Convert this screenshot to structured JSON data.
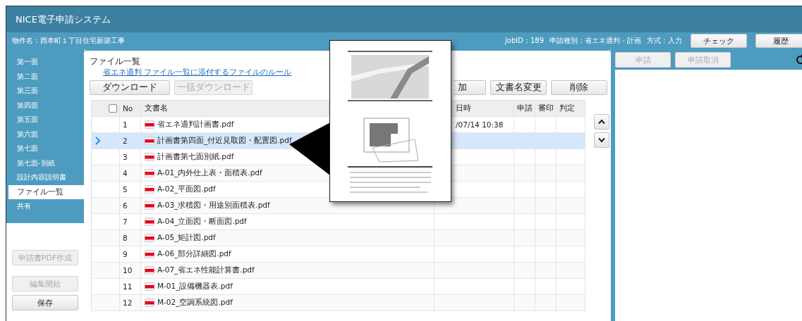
{
  "app_title": "NICE電子申請システム",
  "project_name": "物件名：西本町１丁目住宅新築工事",
  "job_info": [
    "JobID：189",
    "申請種別：省エネ適判 - 計画",
    "方式：入力"
  ],
  "header_buttons": [
    {
      "label": "チェック",
      "disabled": false
    },
    {
      "label": "履歴",
      "disabled": false
    }
  ],
  "sidebar": {
    "items": [
      {
        "label": "第一面",
        "selected": false
      },
      {
        "label": "第二面",
        "selected": false
      },
      {
        "label": "第三面",
        "selected": false
      },
      {
        "label": "第四面",
        "selected": false
      },
      {
        "label": "第五面",
        "selected": false
      },
      {
        "label": "第六面",
        "selected": false
      },
      {
        "label": "第七面",
        "selected": false
      },
      {
        "label": "第七面-別紙",
        "selected": false
      },
      {
        "label": "設計内容説明書",
        "selected": false
      },
      {
        "label": "ファイル一覧",
        "selected": true
      },
      {
        "label": "共有",
        "selected": false
      }
    ],
    "actions": [
      {
        "label": "申請書PDF作成",
        "disabled": true
      },
      {
        "label": "編集開始",
        "disabled": true
      },
      {
        "label": "保存",
        "disabled": false
      }
    ]
  },
  "panel": {
    "title": "ファイル一覧",
    "link": "省エネ適判 ファイル一覧に添付するファイルのルール",
    "left_buttons": [
      {
        "label": "ダウンロード",
        "disabled": false
      },
      {
        "label": "一括ダウンロード",
        "disabled": true
      }
    ],
    "right_buttons": [
      {
        "label": "加",
        "disabled": false
      },
      {
        "label": "文書名変更",
        "disabled": false
      },
      {
        "label": "削除",
        "disabled": false
      }
    ],
    "table": {
      "select_all_checked": false,
      "columns": [
        "No",
        "文書名",
        "日時",
        "申請",
        "審印",
        "判定"
      ],
      "rows": [
        {
          "no": "1",
          "name": "省エネ適判計画書.pdf",
          "date": "/07/14 10:38",
          "selected": false,
          "checked": false
        },
        {
          "no": "2",
          "name": "計画書第四面_付近見取図・配置図.pdf",
          "selected": true,
          "checked": false
        },
        {
          "no": "3",
          "name": "計画書第七面別紙.pdf",
          "selected": false,
          "checked": false
        },
        {
          "no": "4",
          "name": "A-01_内外仕上表・面積表.pdf",
          "selected": false,
          "checked": false
        },
        {
          "no": "5",
          "name": "A-02_平面図.pdf",
          "selected": false,
          "checked": false
        },
        {
          "no": "6",
          "name": "A-03_求積図・用途別面積表.pdf",
          "selected": false,
          "checked": false
        },
        {
          "no": "7",
          "name": "A-04_立面図・断面図.pdf",
          "selected": false,
          "checked": false
        },
        {
          "no": "8",
          "name": "A-05_矩計図.pdf",
          "selected": false,
          "checked": false
        },
        {
          "no": "9",
          "name": "A-06_部分詳細図.pdf",
          "selected": false,
          "checked": false
        },
        {
          "no": "10",
          "name": "A-07_省エネ性能計算書.pdf",
          "selected": false,
          "checked": false
        },
        {
          "no": "11",
          "name": "M-01_設備機器表.pdf",
          "selected": false,
          "checked": false
        },
        {
          "no": "12",
          "name": "M-02_空調系統図.pdf",
          "selected": false,
          "checked": false
        }
      ]
    }
  },
  "right_panel": {
    "buttons": [
      {
        "label": "申請",
        "disabled": true
      },
      {
        "label": "申請取消",
        "disabled": true
      }
    ]
  }
}
